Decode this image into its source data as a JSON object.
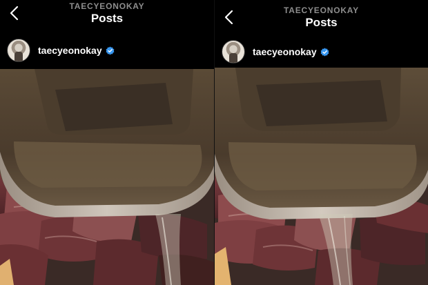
{
  "panels": [
    {
      "header": {
        "username": "TAECYEONOKAY",
        "title": "Posts"
      },
      "post": {
        "account": "taecyeonokay"
      }
    },
    {
      "header": {
        "username": "TAECYEONOKAY",
        "title": "Posts"
      },
      "post": {
        "account": "taecyeonokay"
      }
    }
  ],
  "colors": {
    "background": "#000000",
    "verified_badge": "#3897f0",
    "subtitle": "#8e8e8e"
  },
  "icons": [
    "back-arrow-icon",
    "verified-badge-icon"
  ]
}
